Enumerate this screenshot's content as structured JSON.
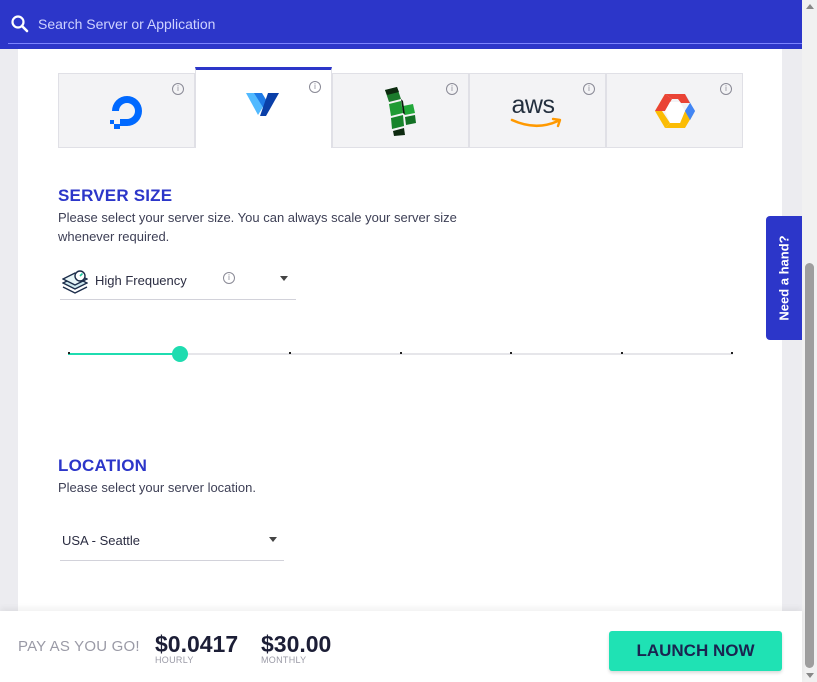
{
  "search": {
    "placeholder": "Search Server or Application"
  },
  "providers": [
    {
      "name": "DigitalOcean",
      "icon": "digitalocean-logo-icon",
      "active": false
    },
    {
      "name": "Vultr",
      "icon": "vultr-logo-icon",
      "active": true
    },
    {
      "name": "Linode",
      "icon": "linode-logo-icon",
      "active": false
    },
    {
      "name": "AWS",
      "icon": "aws-logo-icon",
      "logo_text": "aws",
      "active": false
    },
    {
      "name": "Google Cloud",
      "icon": "google-cloud-logo-icon",
      "active": false
    }
  ],
  "server_size": {
    "title": "SERVER SIZE",
    "description": "Please select your server size. You can always scale your server size whenever required.",
    "plan_type": "High Frequency",
    "slider": {
      "steps": 7,
      "selected_index": 1
    }
  },
  "location": {
    "title": "LOCATION",
    "description": "Please select your server location.",
    "selected": "USA - Seattle"
  },
  "need_hand": {
    "label": "Need a hand?"
  },
  "footer": {
    "pay_label": "PAY AS YOU GO!",
    "hourly_price": "$0.0417",
    "hourly_label": "HOURLY",
    "monthly_price": "$30.00",
    "monthly_label": "MONTHLY",
    "launch_label": "LAUNCH NOW"
  },
  "colors": {
    "brand_blue": "#2c36c9",
    "accent_teal": "#1fe2b4"
  }
}
